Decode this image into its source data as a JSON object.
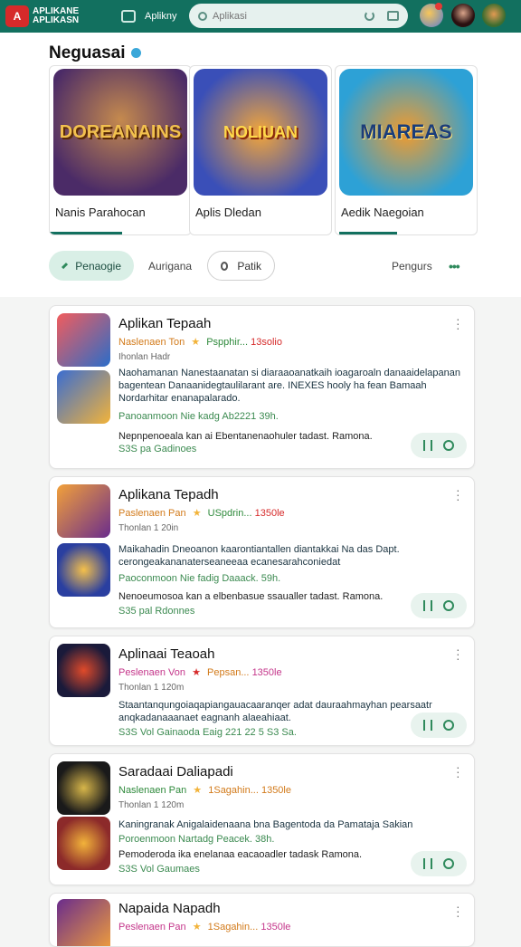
{
  "header": {
    "logo_text": "A",
    "brand": "APLIKANE APLIKASN",
    "nav_label": "Aplikny",
    "search_placeholder": "Aplikasi"
  },
  "featured": {
    "title": "Neguasai",
    "cards": [
      {
        "name": "Nanis Parahocan",
        "art_text": "DOREANAINS"
      },
      {
        "name": "Aplis Dledan",
        "art_text": "NOLIUAN"
      },
      {
        "name": "Aedik Naegoian",
        "art_text": "MIAREAS"
      }
    ]
  },
  "filters": {
    "active": "Penaogie",
    "plain": "Aurigana",
    "outline": "Patik",
    "right": "Pengurs",
    "more": "•••"
  },
  "apps": [
    {
      "title": "Aplikan Tepaah",
      "meta_left": "Naslenaen Ton",
      "meta_mid": "Pspphir...",
      "meta_right": "13solio",
      "meta_color": "#d27a1a",
      "sub": "Ihonlan Hadr",
      "desc": "Naohamanan Nanestaanatan si diaraaoanatkaih ioagaroaln danaaidelapanan bagentean Danaanidegtaulilarant are. INEXES hooly ha fean Bamaah Nordarhitar enanapalarado.",
      "green": "Panoanmoon Nie kadg Ab2221 39h.",
      "foot": "Nepnpenoeala kan ai Ebentanenaohuler tadast. Ramona.",
      "foot2": "S3S pa Gadinoes"
    },
    {
      "title": "Aplikana Tepadh",
      "meta_left": "Paslenaen Pan",
      "meta_mid": "USpdrin...",
      "meta_right": "1350le",
      "meta_color": "#d27a1a",
      "sub": "Thonlan 1 20in",
      "desc": "Maikahadin Dneoanon kaarontiantallen diantakkai Na das Dapt. cerongeakananaterseaneeaa ecanesarahconiedat",
      "green": "Paoconmoon Nie fadig Daaack. 59h.",
      "foot": "Nenoeumosoa kan a elbenbasue ssaualler tadast. Ramona.",
      "foot2": "S35 pal Rdonnes"
    },
    {
      "title": "Aplinaai Teaoah",
      "meta_left": "Peslenaen Von",
      "meta_mid": "Pepsan...",
      "meta_right": "1350le",
      "meta_color": "#c4358a",
      "sub": "Thonlan 1 120m",
      "desc": "Staantanqungoiaqapiangauacaaranqer adat dauraahmayhan pearsaatr anqkadanaaanaet eagnanh alaeahiaat.",
      "green": "",
      "foot": "",
      "foot2": "S3S Vol Gainaoda Eaig 221 22 5 S3 Sa."
    },
    {
      "title": "Saradaai Daliapadi",
      "meta_left": "Naslenaen Pan",
      "meta_mid": "1Sagahin...",
      "meta_right": "1350le",
      "meta_color": "#2f8a3c",
      "sub": "Thonlan 1 120m",
      "desc": "Kaningranak Anigalaidenaana bna Bagentoda da Pamataja Sakian",
      "green": "Poroenmoon Nartadg Peacek. 38h.",
      "foot": "Pemoderoda ika enelanaa eacaoadler tadask Ramona.",
      "foot2": "S3S Vol Gaumaes"
    },
    {
      "title": "Napaida Napadh",
      "meta_left": "Peslenaen Pan",
      "meta_mid": "1Sagahin...",
      "meta_right": "1350le",
      "meta_color": "#c4358a",
      "sub": "",
      "desc": "",
      "green": "",
      "foot": "",
      "foot2": ""
    }
  ]
}
